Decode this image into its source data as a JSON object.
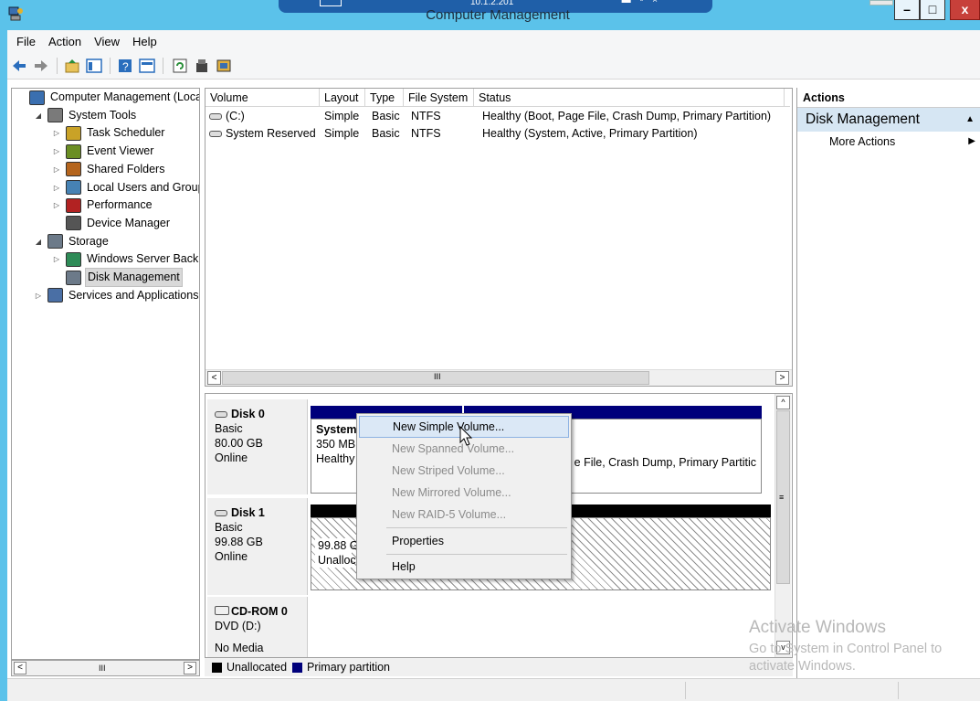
{
  "window": {
    "title": "Computer Management",
    "rdp_ip": "10.1.2.201",
    "minimize": "–",
    "maximize": "□",
    "close": "x"
  },
  "menu": [
    "File",
    "Action",
    "View",
    "Help"
  ],
  "tree": {
    "items": [
      {
        "label": "Computer Management (Local",
        "expander": "",
        "indent": 0,
        "icon": "computer-management-icon",
        "selected": false
      },
      {
        "label": "System Tools",
        "expander": "◢",
        "indent": 1,
        "icon": "system-tools-icon",
        "selected": false
      },
      {
        "label": "Task Scheduler",
        "expander": "▷",
        "indent": 2,
        "icon": "clock-icon",
        "selected": false
      },
      {
        "label": "Event Viewer",
        "expander": "▷",
        "indent": 2,
        "icon": "event-viewer-icon",
        "selected": false
      },
      {
        "label": "Shared Folders",
        "expander": "▷",
        "indent": 2,
        "icon": "shared-folder-icon",
        "selected": false
      },
      {
        "label": "Local Users and Groups",
        "expander": "▷",
        "indent": 2,
        "icon": "users-icon",
        "selected": false
      },
      {
        "label": "Performance",
        "expander": "▷",
        "indent": 2,
        "icon": "performance-icon",
        "selected": false
      },
      {
        "label": "Device Manager",
        "expander": "",
        "indent": 2,
        "icon": "device-manager-icon",
        "selected": false
      },
      {
        "label": "Storage",
        "expander": "◢",
        "indent": 1,
        "icon": "storage-icon",
        "selected": false
      },
      {
        "label": "Windows Server Backup",
        "expander": "▷",
        "indent": 2,
        "icon": "backup-icon",
        "selected": false
      },
      {
        "label": "Disk Management",
        "expander": "",
        "indent": 2,
        "icon": "disk-management-icon",
        "selected": true
      },
      {
        "label": "Services and Applications",
        "expander": "▷",
        "indent": 1,
        "icon": "services-icon",
        "selected": false
      }
    ]
  },
  "volume_list": {
    "columns": [
      "Volume",
      "Layout",
      "Type",
      "File System",
      "Status"
    ],
    "rows": [
      {
        "volume": "(C:)",
        "layout": "Simple",
        "type": "Basic",
        "fs": "NTFS",
        "status": "Healthy (Boot, Page File, Crash Dump, Primary Partition)"
      },
      {
        "volume": "System Reserved",
        "layout": "Simple",
        "type": "Basic",
        "fs": "NTFS",
        "status": "Healthy (System, Active, Primary Partition)"
      }
    ],
    "scroll_grip": "III"
  },
  "disks": {
    "disk0": {
      "name": "Disk 0",
      "type": "Basic",
      "size": "80.00 GB",
      "state": "Online",
      "part1": {
        "name": "System",
        "size": "350 MB",
        "status": "Healthy"
      },
      "part2_status": "e File, Crash Dump, Primary Partitic"
    },
    "disk1": {
      "name": "Disk 1",
      "type": "Basic",
      "size": "99.88 GB",
      "state": "Online",
      "part1": {
        "size": "99.88 G",
        "status": "Unalloc"
      }
    },
    "cdrom0": {
      "name": "CD-ROM 0",
      "drive": "DVD (D:)",
      "media": "No Media"
    }
  },
  "legend": {
    "unallocated": "Unallocated",
    "primary": "Primary partition",
    "colors": {
      "unallocated": "#000000",
      "primary": "#00007b"
    }
  },
  "actions": {
    "header": "Actions",
    "section": "Disk Management",
    "item": "More Actions"
  },
  "context_menu": {
    "items": [
      {
        "label": "New Simple Volume...",
        "state": "hover"
      },
      {
        "label": "New Spanned Volume...",
        "state": "disabled"
      },
      {
        "label": "New Striped Volume...",
        "state": "disabled"
      },
      {
        "label": "New Mirrored Volume...",
        "state": "disabled"
      },
      {
        "label": "New RAID-5 Volume...",
        "state": "disabled"
      },
      {
        "label": "Properties",
        "state": "enabled"
      },
      {
        "label": "Help",
        "state": "enabled"
      }
    ]
  },
  "watermark": {
    "line1": "Activate Windows",
    "line2": "Go to System in Control Panel to",
    "line3": "activate Windows."
  },
  "colors": {
    "titlebar": "#5bc2ea",
    "partition_header": "#00007b",
    "selection": "#dbe8f6",
    "actions_section": "#d6e6f3"
  }
}
